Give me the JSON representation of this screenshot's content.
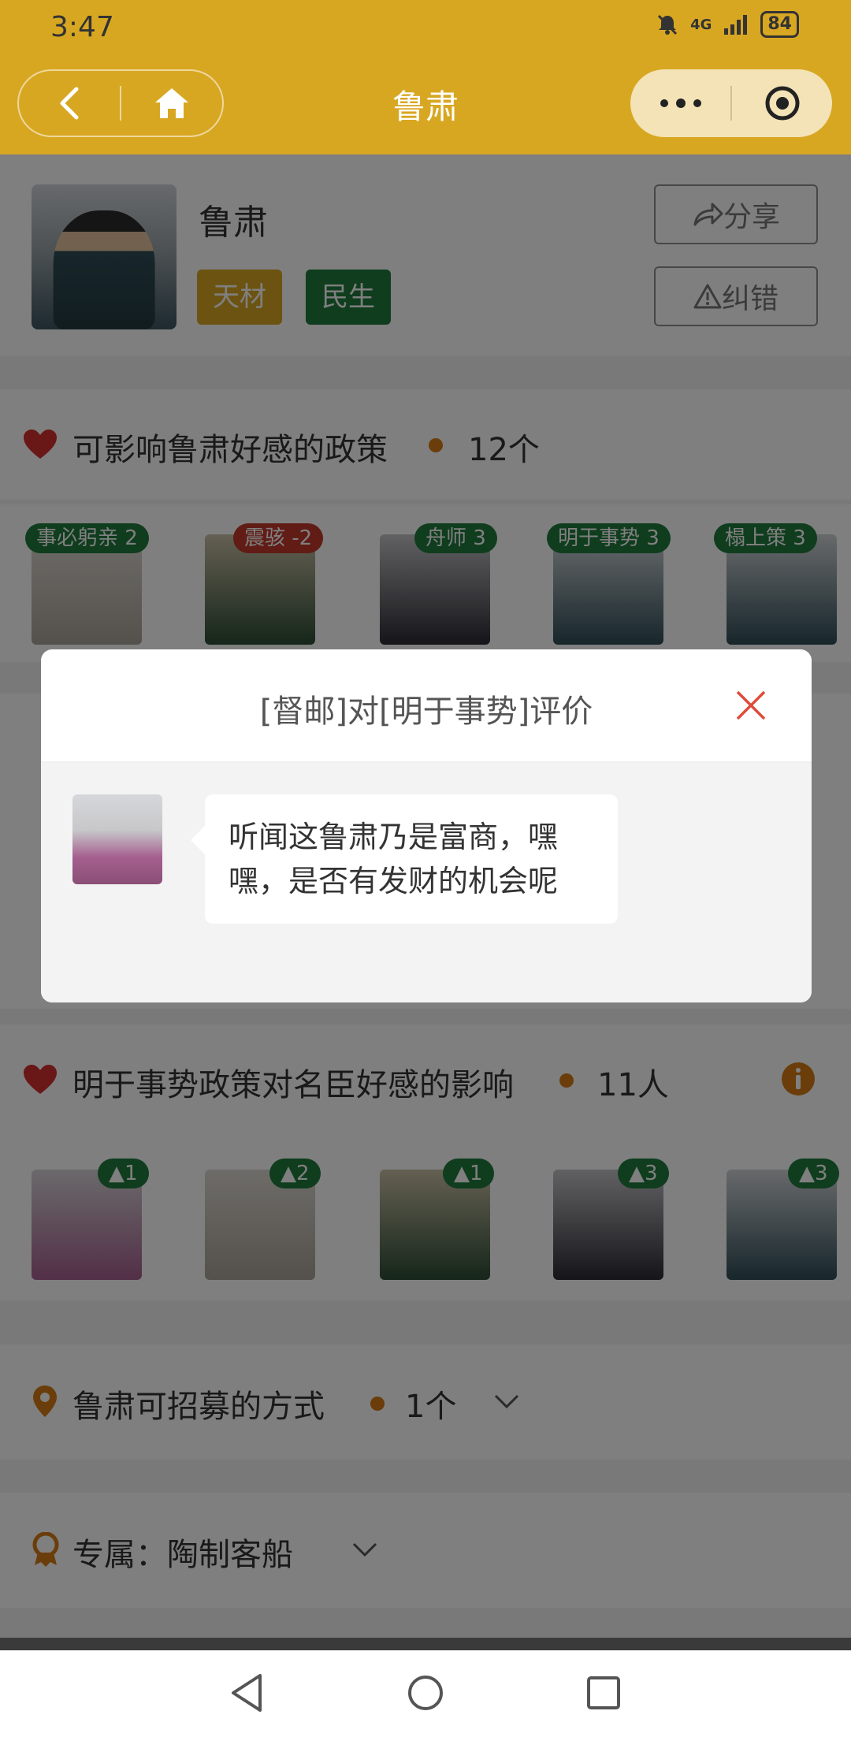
{
  "status_bar": {
    "time": "3:47",
    "network": "4G",
    "battery": "84"
  },
  "nav": {
    "title": "鲁肃"
  },
  "profile": {
    "name": "鲁肃",
    "tags": [
      "天材",
      "民生"
    ],
    "share_label": "分享",
    "report_label": "纠错"
  },
  "policies": {
    "title": "可影响鲁肃好感的政策",
    "count": "12个",
    "items": [
      {
        "label": "事必躬亲 2"
      },
      {
        "label": "震骇 -2"
      },
      {
        "label": "舟师 3"
      },
      {
        "label": "明于事势 3"
      },
      {
        "label": "榻上策 3"
      }
    ]
  },
  "impact": {
    "title": "明于事势政策对名臣好感的影响",
    "count": "11人",
    "items": [
      {
        "label": "▲1"
      },
      {
        "label": "▲2"
      },
      {
        "label": "▲1"
      },
      {
        "label": "▲3"
      },
      {
        "label": "▲3"
      }
    ]
  },
  "recruit": {
    "title": "鲁肃可招募的方式",
    "count": "1个"
  },
  "exclusive": {
    "label": "专属：陶制客船"
  },
  "modal": {
    "title": "[督邮]对[明于事势]评价",
    "comment": "听闻这鲁肃乃是富商，嘿嘿，是否有发财的机会呢"
  },
  "colors": {
    "accent": "#d8a722",
    "green": "#1f7a3c",
    "red": "#c0392b",
    "orange": "#d57a15"
  }
}
